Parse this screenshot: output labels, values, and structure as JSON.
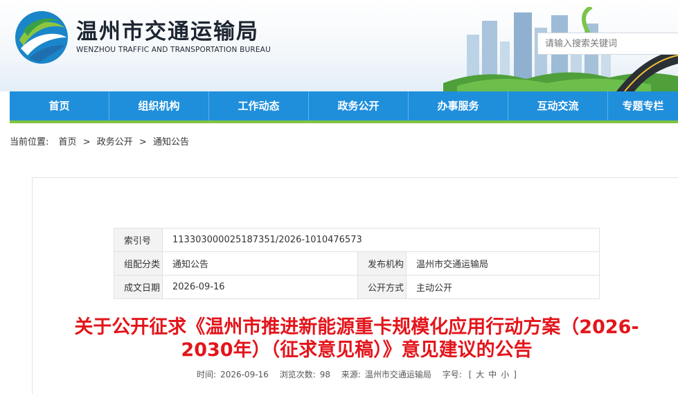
{
  "header": {
    "title": "温州市交通运输局",
    "subtitle": "WENZHOU TRAFFIC AND TRANSPORTATION BUREAU",
    "search_placeholder": "请输入搜索关键词"
  },
  "nav": {
    "items": [
      "首页",
      "组织机构",
      "工作动态",
      "政务公开",
      "办事服务",
      "互动交流",
      "专题专栏"
    ]
  },
  "breadcrumb": {
    "prefix": "当前位置:",
    "items": [
      "首页",
      "政务公开",
      "通知公告"
    ],
    "separator": ">"
  },
  "meta_table": {
    "index_label": "索引号",
    "index_value": "113303000025187351/2026-1010476573",
    "category_label": "组配分类",
    "category_value": "通知公告",
    "publisher_label": "发布机构",
    "publisher_value": "温州市交通运输局",
    "date_label": "成文日期",
    "date_value": "2026-09-16",
    "disclosure_label": "公开方式",
    "disclosure_value": "主动公开"
  },
  "article": {
    "title": "关于公开征求《温州市推进新能源重卡规模化应用行动方案（2026-2030年）（征求意见稿）》意见建议的公告",
    "time_label": "时间:",
    "time_value": "2026-09-16",
    "views_label": "浏览次数:",
    "views_value": "98",
    "source_label": "来源:",
    "source_value": "温州市交通运输局",
    "font_label": "字号:",
    "font_open": "[",
    "font_large": "大",
    "font_medium": "中",
    "font_small": "小",
    "font_close": "]"
  },
  "colors": {
    "nav_bg": "#1f8fdc",
    "nav_accent": "#82c341",
    "title_red": "#e3151b"
  }
}
